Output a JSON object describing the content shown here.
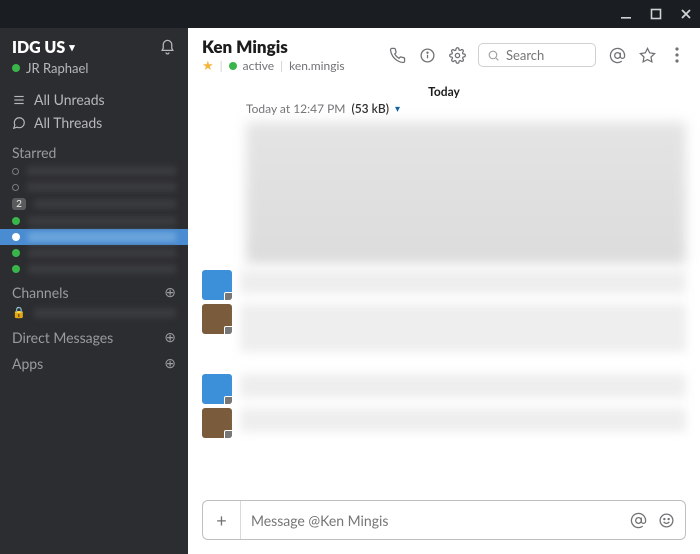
{
  "workspace": {
    "name": "IDG US",
    "user": "JR Raphael"
  },
  "sidebar": {
    "all_unreads": "All Unreads",
    "all_threads": "All Threads",
    "starred_label": "Starred",
    "channels_label": "Channels",
    "dms_label": "Direct Messages",
    "apps_label": "Apps",
    "starred": [
      {
        "presence": "empty",
        "badge": ""
      },
      {
        "presence": "empty",
        "badge": ""
      },
      {
        "presence": "badge",
        "badge": "2"
      },
      {
        "presence": "online",
        "badge": ""
      },
      {
        "presence": "selected",
        "badge": ""
      },
      {
        "presence": "half",
        "badge": ""
      },
      {
        "presence": "online",
        "badge": ""
      }
    ]
  },
  "conversation": {
    "name": "Ken Mingis",
    "status_word": "active",
    "username": "ken.mingis",
    "search_placeholder": "Search",
    "day_label": "Today",
    "file_time": "Today at 12:47 PM",
    "file_size": "(53 kB)",
    "composer_placeholder": "Message @Ken Mingis"
  },
  "icons": {
    "minimize": "minimize-icon",
    "maximize": "maximize-icon",
    "close": "close-icon",
    "bell": "bell-icon",
    "phone": "phone-icon",
    "info": "info-icon",
    "gear": "gear-icon",
    "at": "at-icon",
    "star": "star-icon",
    "more": "more-icon",
    "search": "search-icon",
    "emoji": "emoji-icon",
    "plus": "plus-icon"
  }
}
